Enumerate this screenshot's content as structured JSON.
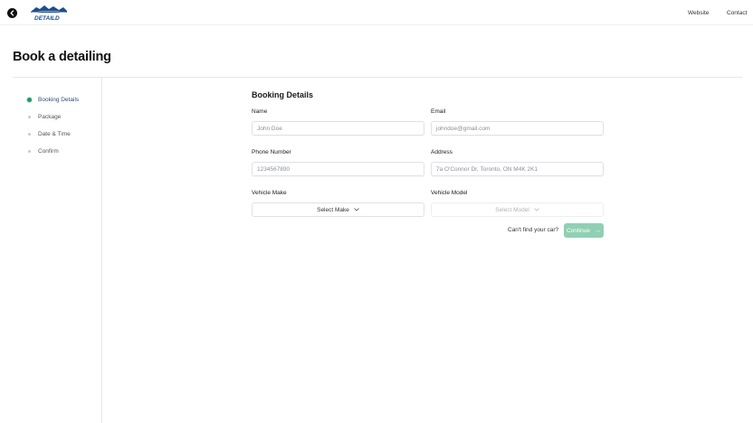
{
  "header": {
    "logo_text": "DETAILD",
    "nav": {
      "website": "Website",
      "contact": "Contact"
    }
  },
  "page": {
    "title": "Book a detailing"
  },
  "sidebar": {
    "steps": [
      {
        "label": "Booking Details",
        "active": true
      },
      {
        "label": "Package",
        "active": false
      },
      {
        "label": "Date & Time",
        "active": false
      },
      {
        "label": "Confirm",
        "active": false
      }
    ]
  },
  "form": {
    "title": "Booking Details",
    "name": {
      "label": "Name",
      "placeholder": "John Doe"
    },
    "email": {
      "label": "Email",
      "placeholder": "johndoe@gmail.com"
    },
    "phone": {
      "label": "Phone Number",
      "placeholder": "1234567890"
    },
    "address": {
      "label": "Address",
      "placeholder": "7a O'Connor Dr, Toronto, ON M4K 2K1"
    },
    "vehicle_make": {
      "label": "Vehicle Make",
      "value": "Select Make"
    },
    "vehicle_model": {
      "label": "Vehicle Model",
      "value": "Select Model"
    },
    "cant_find": "Can't find your car?",
    "continue_label": "Continue"
  },
  "colors": {
    "accent": "#1f9a66",
    "continue_bg": "#8fd0b3",
    "logo_blue": "#1e4f8c",
    "active_step_text": "#2d4f7a"
  }
}
